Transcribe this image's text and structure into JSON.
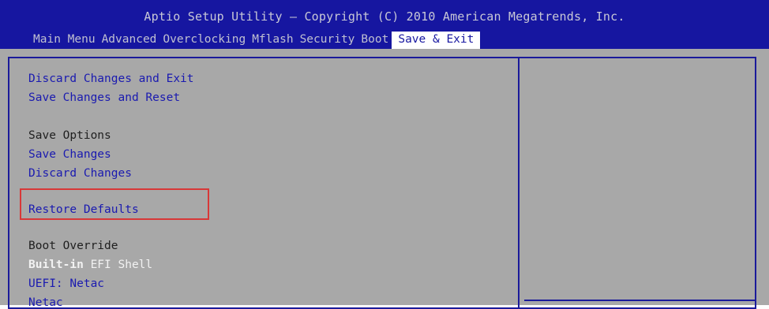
{
  "header": {
    "title": "Aptio Setup Utility – Copyright (C) 2010 American Megatrends, Inc.",
    "tabs": [
      {
        "label": "Main Menu",
        "active": false
      },
      {
        "label": "Advanced",
        "active": false
      },
      {
        "label": "Overclocking",
        "active": false
      },
      {
        "label": "Mflash",
        "active": false
      },
      {
        "label": "Security",
        "active": false
      },
      {
        "label": "Boot",
        "active": false
      },
      {
        "label": "Save & Exit",
        "active": true
      }
    ]
  },
  "menu": {
    "discard_exit": "Discard Changes and Exit",
    "save_reset": "Save Changes and Reset",
    "save_options_heading": "Save Options",
    "save_changes": "Save Changes",
    "discard_changes": "Discard Changes",
    "restore_defaults": "Restore Defaults",
    "boot_override_heading": "Boot Override",
    "builtin_prefix": "Built-in",
    "builtin_rest": " EFI Shell",
    "uefi_netac": "UEFI: Netac",
    "netac": "Netac"
  },
  "colors": {
    "header_bg": "#1616a0",
    "body_bg": "#a8a8a8",
    "link_blue": "#1a1ab0",
    "highlight_red": "#d83838"
  }
}
